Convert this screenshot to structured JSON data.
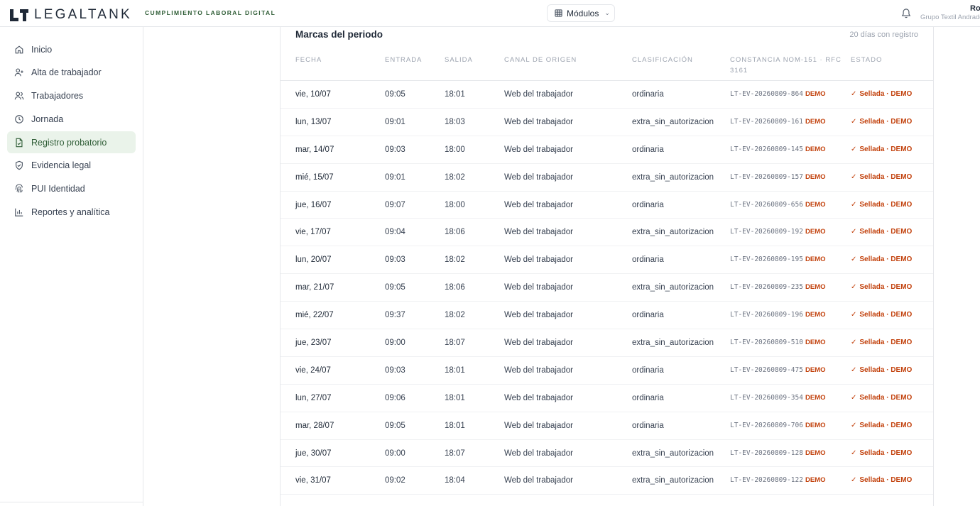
{
  "header": {
    "brand_name": "LEGALTANK",
    "brand_tag": "CUMPLIMIENTO LABORAL DIGITAL",
    "modules_label": "Módulos",
    "user_name": "Ro",
    "user_org": "Grupo Textil Andrade"
  },
  "sidebar": {
    "items": [
      {
        "label": "Inicio",
        "icon": "home-icon"
      },
      {
        "label": "Alta de trabajador",
        "icon": "user-plus-icon"
      },
      {
        "label": "Trabajadores",
        "icon": "users-icon"
      },
      {
        "label": "Jornada",
        "icon": "clock-icon"
      },
      {
        "label": "Registro probatorio",
        "icon": "file-check-icon",
        "active": true
      },
      {
        "label": "Evidencia legal",
        "icon": "shield-check-icon"
      },
      {
        "label": "PUI Identidad",
        "icon": "fingerprint-icon"
      },
      {
        "label": "Reportes y analítica",
        "icon": "bar-chart-icon"
      }
    ]
  },
  "main": {
    "title": "Marcas del periodo",
    "count_text": "20 días con registro",
    "columns": {
      "fecha": "FECHA",
      "entrada": "ENTRADA",
      "salida": "SALIDA",
      "canal": "CANAL DE ORIGEN",
      "clasificacion": "CLASIFICACIÓN",
      "constancia": "CONSTANCIA NOM-151 · RFC 3161",
      "estado": "ESTADO"
    },
    "rows": [
      {
        "fecha": "vie, 10/07",
        "entrada": "09:05",
        "salida": "18:01",
        "canal": "Web del trabajador",
        "clasificacion": "ordinaria",
        "constancia": "LT-EV-20260809-864",
        "demo": "DEMO",
        "estado": "Sellada · DEMO"
      },
      {
        "fecha": "lun, 13/07",
        "entrada": "09:01",
        "salida": "18:03",
        "canal": "Web del trabajador",
        "clasificacion": "extra_sin_autorizacion",
        "constancia": "LT-EV-20260809-161",
        "demo": "DEMO",
        "estado": "Sellada · DEMO"
      },
      {
        "fecha": "mar, 14/07",
        "entrada": "09:03",
        "salida": "18:00",
        "canal": "Web del trabajador",
        "clasificacion": "ordinaria",
        "constancia": "LT-EV-20260809-145",
        "demo": "DEMO",
        "estado": "Sellada · DEMO"
      },
      {
        "fecha": "mié, 15/07",
        "entrada": "09:01",
        "salida": "18:02",
        "canal": "Web del trabajador",
        "clasificacion": "extra_sin_autorizacion",
        "constancia": "LT-EV-20260809-157",
        "demo": "DEMO",
        "estado": "Sellada · DEMO"
      },
      {
        "fecha": "jue, 16/07",
        "entrada": "09:07",
        "salida": "18:00",
        "canal": "Web del trabajador",
        "clasificacion": "ordinaria",
        "constancia": "LT-EV-20260809-656",
        "demo": "DEMO",
        "estado": "Sellada · DEMO"
      },
      {
        "fecha": "vie, 17/07",
        "entrada": "09:04",
        "salida": "18:06",
        "canal": "Web del trabajador",
        "clasificacion": "extra_sin_autorizacion",
        "constancia": "LT-EV-20260809-192",
        "demo": "DEMO",
        "estado": "Sellada · DEMO"
      },
      {
        "fecha": "lun, 20/07",
        "entrada": "09:03",
        "salida": "18:02",
        "canal": "Web del trabajador",
        "clasificacion": "ordinaria",
        "constancia": "LT-EV-20260809-195",
        "demo": "DEMO",
        "estado": "Sellada · DEMO"
      },
      {
        "fecha": "mar, 21/07",
        "entrada": "09:05",
        "salida": "18:06",
        "canal": "Web del trabajador",
        "clasificacion": "extra_sin_autorizacion",
        "constancia": "LT-EV-20260809-235",
        "demo": "DEMO",
        "estado": "Sellada · DEMO"
      },
      {
        "fecha": "mié, 22/07",
        "entrada": "09:37",
        "salida": "18:02",
        "canal": "Web del trabajador",
        "clasificacion": "ordinaria",
        "constancia": "LT-EV-20260809-196",
        "demo": "DEMO",
        "estado": "Sellada · DEMO"
      },
      {
        "fecha": "jue, 23/07",
        "entrada": "09:00",
        "salida": "18:07",
        "canal": "Web del trabajador",
        "clasificacion": "extra_sin_autorizacion",
        "constancia": "LT-EV-20260809-510",
        "demo": "DEMO",
        "estado": "Sellada · DEMO"
      },
      {
        "fecha": "vie, 24/07",
        "entrada": "09:03",
        "salida": "18:01",
        "canal": "Web del trabajador",
        "clasificacion": "ordinaria",
        "constancia": "LT-EV-20260809-475",
        "demo": "DEMO",
        "estado": "Sellada · DEMO"
      },
      {
        "fecha": "lun, 27/07",
        "entrada": "09:06",
        "salida": "18:01",
        "canal": "Web del trabajador",
        "clasificacion": "ordinaria",
        "constancia": "LT-EV-20260809-354",
        "demo": "DEMO",
        "estado": "Sellada · DEMO"
      },
      {
        "fecha": "mar, 28/07",
        "entrada": "09:05",
        "salida": "18:01",
        "canal": "Web del trabajador",
        "clasificacion": "ordinaria",
        "constancia": "LT-EV-20260809-706",
        "demo": "DEMO",
        "estado": "Sellada · DEMO"
      },
      {
        "fecha": "jue, 30/07",
        "entrada": "09:00",
        "salida": "18:07",
        "canal": "Web del trabajador",
        "clasificacion": "extra_sin_autorizacion",
        "constancia": "LT-EV-20260809-128",
        "demo": "DEMO",
        "estado": "Sellada · DEMO"
      },
      {
        "fecha": "vie, 31/07",
        "entrada": "09:02",
        "salida": "18:04",
        "canal": "Web del trabajador",
        "clasificacion": "extra_sin_autorizacion",
        "constancia": "LT-EV-20260809-122",
        "demo": "DEMO",
        "estado": "Sellada · DEMO"
      }
    ]
  },
  "colors": {
    "accent": "#2f5d36",
    "active_bg": "#eaf3ea",
    "demo": "#c2410c"
  }
}
